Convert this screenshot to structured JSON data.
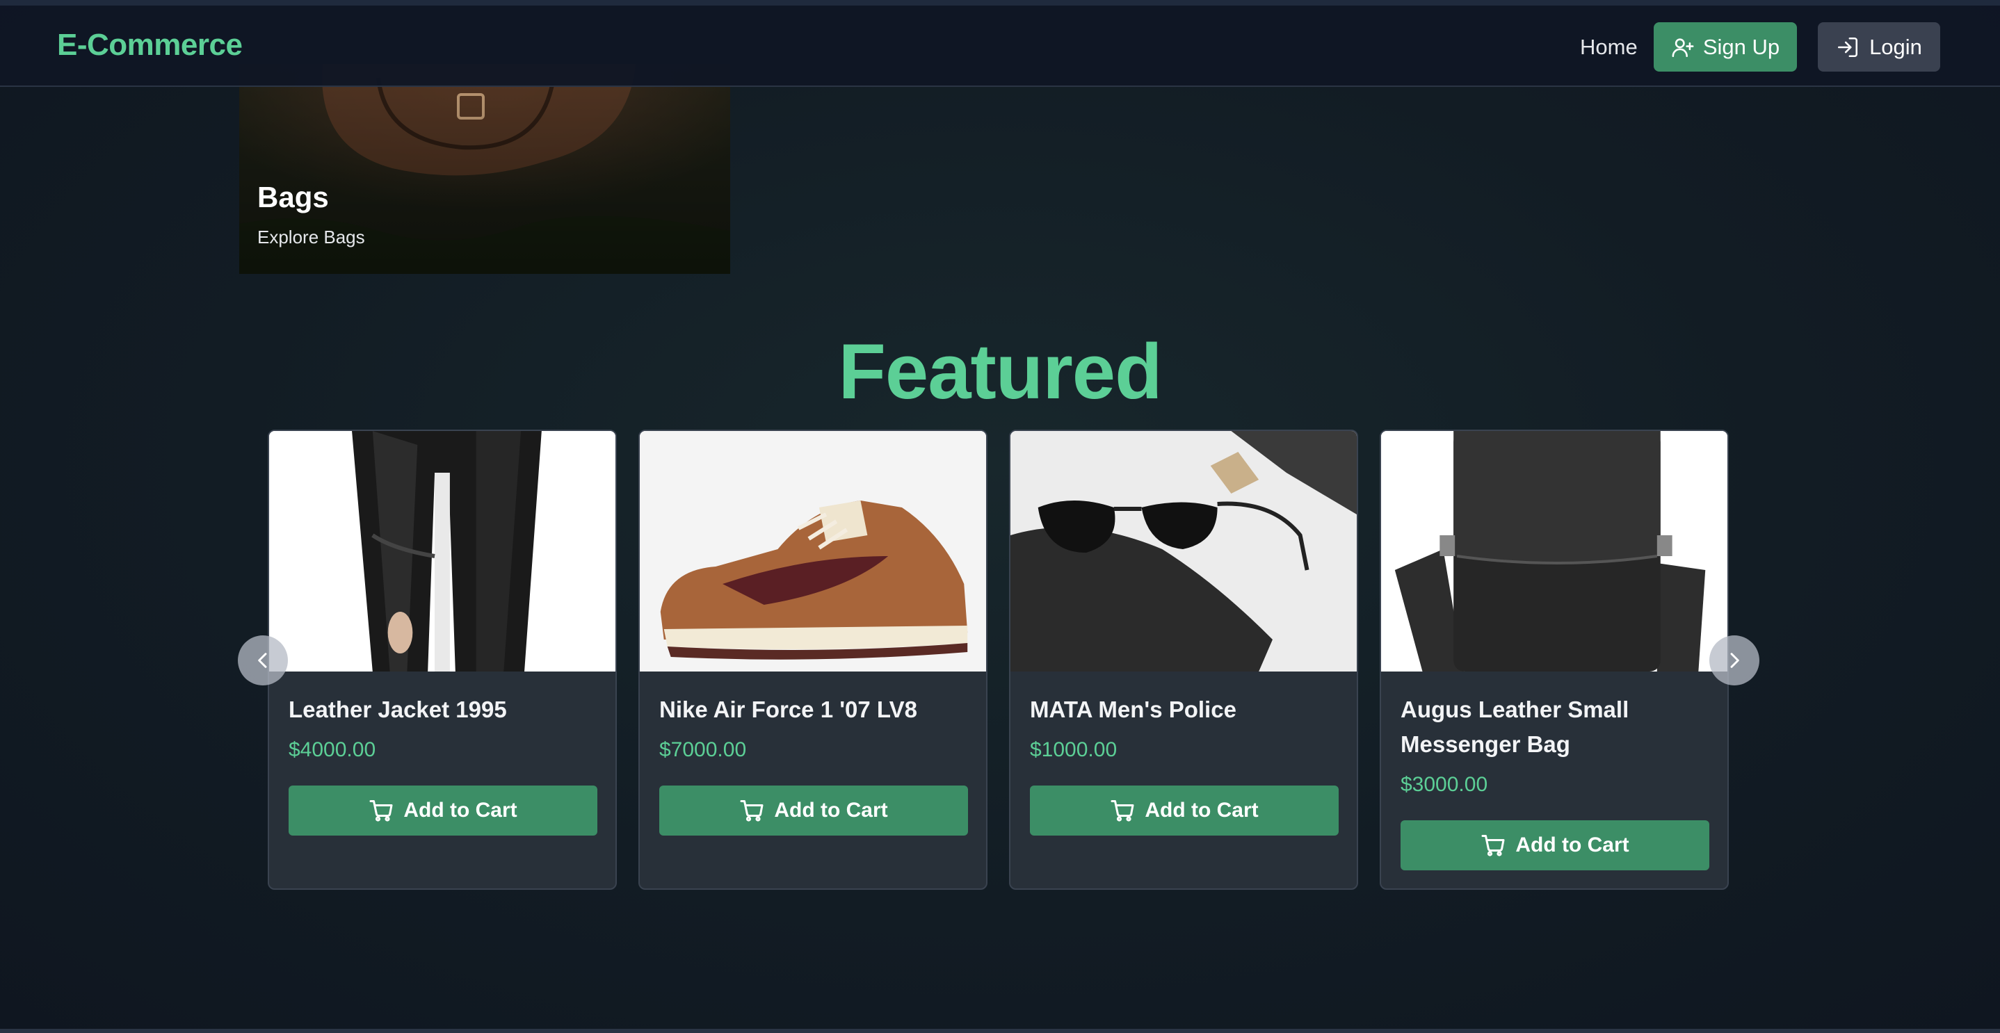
{
  "nav": {
    "brand": "E-Commerce",
    "home": "Home",
    "signup": "Sign Up",
    "login": "Login"
  },
  "category": {
    "title": "Bags",
    "subtitle": "Explore Bags"
  },
  "featured": {
    "title": "Featured",
    "products": [
      {
        "name": "Leather Jacket 1995",
        "price": "$4000.00",
        "button": "Add to Cart"
      },
      {
        "name": "Nike Air Force 1 '07 LV8",
        "price": "$7000.00",
        "button": "Add to Cart"
      },
      {
        "name": "MATA Men's Police",
        "price": "$1000.00",
        "button": "Add to Cart"
      },
      {
        "name": "Augus Leather Small Messenger Bag",
        "price": "$3000.00",
        "button": "Add to Cart"
      }
    ]
  },
  "colors": {
    "accent": "#5ccf96",
    "button_green": "#3c8e66",
    "card_bg": "#283039",
    "nav_bg": "#101624"
  },
  "icons": {
    "signup": "user-plus-icon",
    "login": "login-icon",
    "cart": "cart-icon",
    "prev": "chevron-left-icon",
    "next": "chevron-right-icon"
  }
}
